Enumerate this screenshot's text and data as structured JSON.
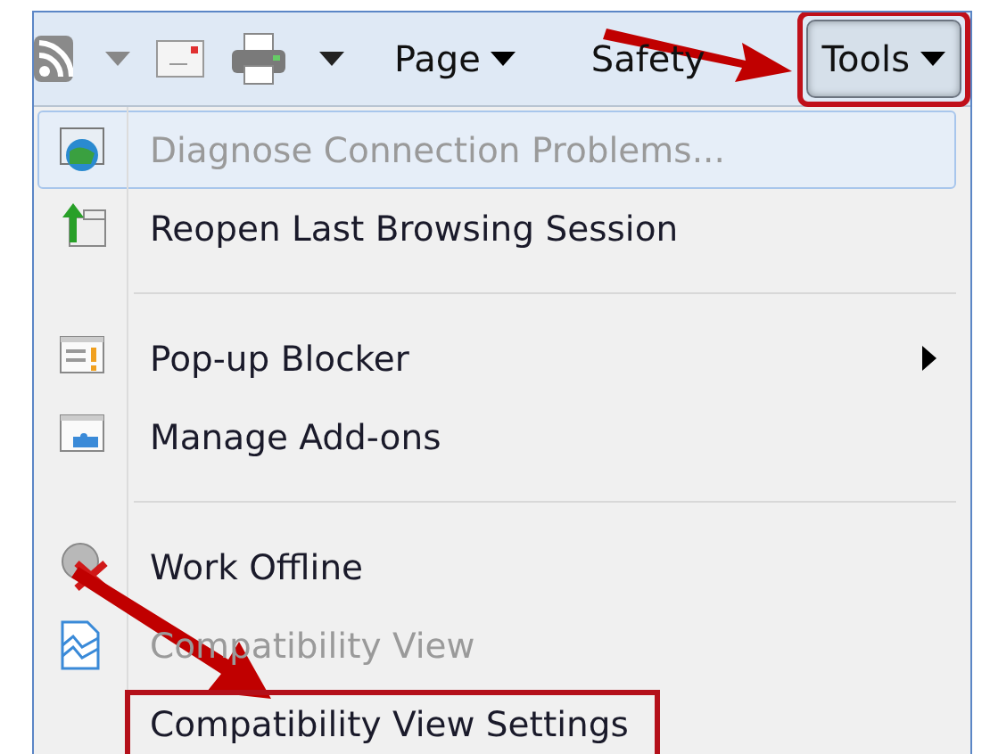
{
  "toolbar": {
    "items": [
      {
        "kind": "feed",
        "caret": true
      },
      {
        "kind": "mail",
        "caret": false
      },
      {
        "kind": "print",
        "caret": true
      },
      {
        "kind": "menu",
        "label": "Page",
        "caret": true,
        "pressed": false,
        "annotated": false
      },
      {
        "kind": "menu",
        "label": "Safety",
        "caret": false,
        "pressed": false,
        "annotated": false
      },
      {
        "kind": "menu",
        "label": "Tools",
        "caret": true,
        "pressed": true,
        "annotated": true
      }
    ]
  },
  "menu": {
    "items": [
      {
        "kind": "item",
        "label": "Diagnose Connection Problems...",
        "disabled": true,
        "highlighted": true,
        "submenu": false,
        "annotated": false
      },
      {
        "kind": "item",
        "label": "Reopen Last Browsing Session",
        "disabled": false,
        "highlighted": false,
        "submenu": false,
        "annotated": false
      },
      {
        "kind": "separator"
      },
      {
        "kind": "item",
        "label": "Pop-up Blocker",
        "disabled": false,
        "highlighted": false,
        "submenu": true,
        "annotated": false
      },
      {
        "kind": "item",
        "label": "Manage Add-ons",
        "disabled": false,
        "highlighted": false,
        "submenu": false,
        "annotated": false
      },
      {
        "kind": "separator"
      },
      {
        "kind": "item",
        "label": "Work Offline",
        "disabled": false,
        "highlighted": false,
        "submenu": false,
        "annotated": false
      },
      {
        "kind": "item",
        "label": "Compatibility View",
        "disabled": true,
        "highlighted": false,
        "submenu": false,
        "annotated": false
      },
      {
        "kind": "item",
        "label": "Compatibility View Settings",
        "disabled": false,
        "highlighted": false,
        "submenu": false,
        "annotated": true
      }
    ]
  }
}
